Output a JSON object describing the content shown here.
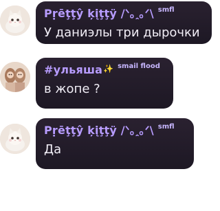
{
  "messages": [
    {
      "author": "Pṛēţţŷ ķįţţÿ /ᐠ｡ꞈ｡ᐟ\\",
      "tag": "smfl",
      "text": "У даниэлы три дырочки"
    },
    {
      "author": "#ульяша",
      "sparkle": "✨",
      "tag": "smail flood",
      "text": "в жопе ?"
    },
    {
      "author": "Pṛēţţŷ ķįţţÿ /ᐠ｡ꞈ｡ᐟ\\",
      "tag": "smfl",
      "text": "Да"
    }
  ],
  "colors": {
    "bubble": "#1f1a27",
    "author": "#b79cff",
    "tag": "#c8b7ff",
    "message_text": "#f1eef6"
  },
  "icons": [
    "avatar-kitty",
    "avatar-ulyasha",
    "sparkle-icon"
  ]
}
